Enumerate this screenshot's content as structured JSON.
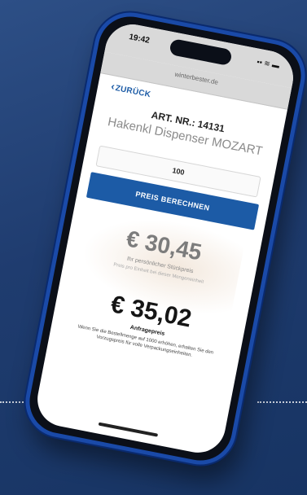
{
  "status": {
    "time": "19:42",
    "url": "winterbester.de"
  },
  "nav": {
    "back_label": "ZURÜCK"
  },
  "product": {
    "art_nr": "ART. NR.: 14131",
    "name": "Hakenkl Dispenser MOZART"
  },
  "form": {
    "quantity": "100",
    "calc_button_label": "PREIS BERECHNEN"
  },
  "prices": {
    "individual": "€ 30,45",
    "individual_label": "Ihr persönlicher Stückpreis",
    "individual_note": "Preis pro Einheit bei dieser Mengeneinheit",
    "list": "€ 35,02",
    "list_label": "Anfragepreis",
    "list_note": "Wenn Sie die Bestellmenge auf 1000 erhöhen, erhalten Sie den Vorzugspreis für volle Verpackungseinheiten."
  },
  "colors": {
    "accent": "#1c5ba6",
    "phone_frame": "#1a4aa8",
    "background": "#1f3c6f"
  }
}
